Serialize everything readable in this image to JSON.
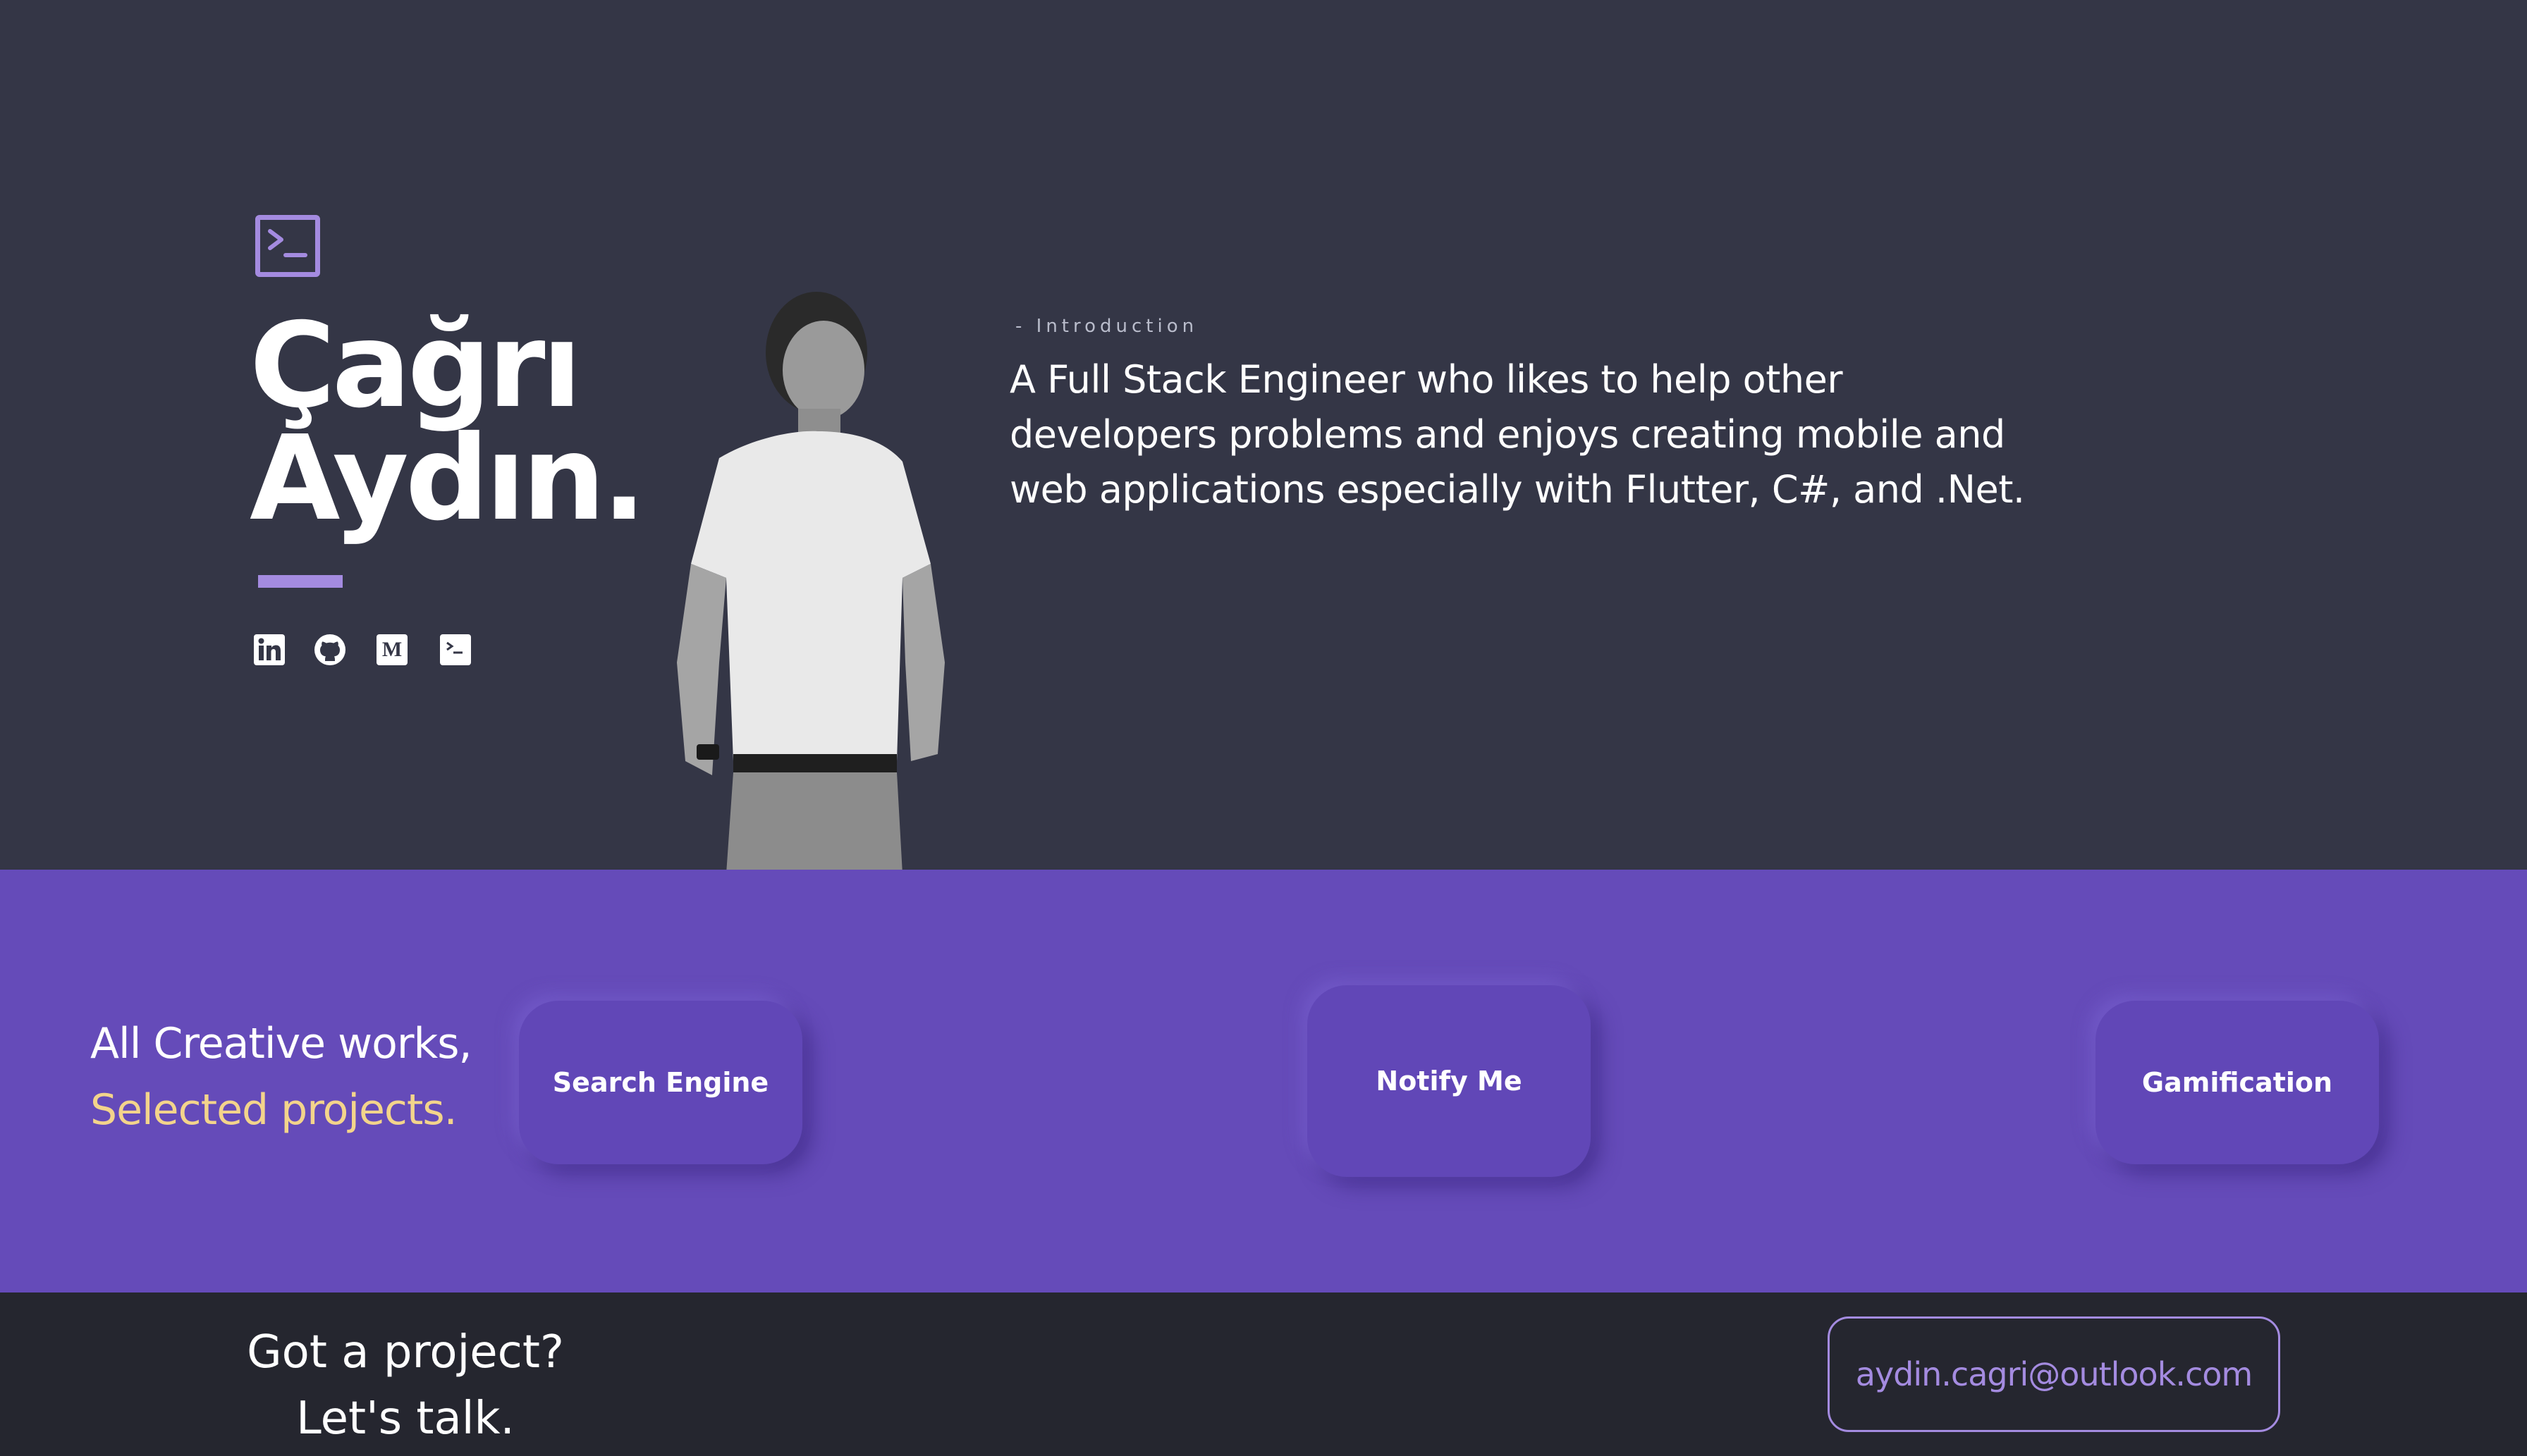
{
  "hero": {
    "name_line1": "Çağrı",
    "name_line2": "Aydın.",
    "intro_label": "- Introduction",
    "intro_text": "A Full Stack Engineer who likes to help other developers problems and enjoys creating mobile and web applications especially with Flutter, C#, and .Net.",
    "social_icons": [
      "linkedin-icon",
      "github-icon",
      "medium-icon",
      "terminal-icon"
    ],
    "accent_color": "#a48be0"
  },
  "projects": {
    "heading_line1": "All Creative works,",
    "heading_line2": "Selected projects.",
    "items": [
      {
        "label": "Search Engine"
      },
      {
        "label": "Notify Me"
      },
      {
        "label": "Gamification"
      }
    ],
    "band_color": "#654bb9",
    "highlight_color": "#f3d48b"
  },
  "footer": {
    "cta_line1": "Got a project?",
    "cta_line2": "Let's talk.",
    "email": "aydin.cagri@outlook.com"
  }
}
